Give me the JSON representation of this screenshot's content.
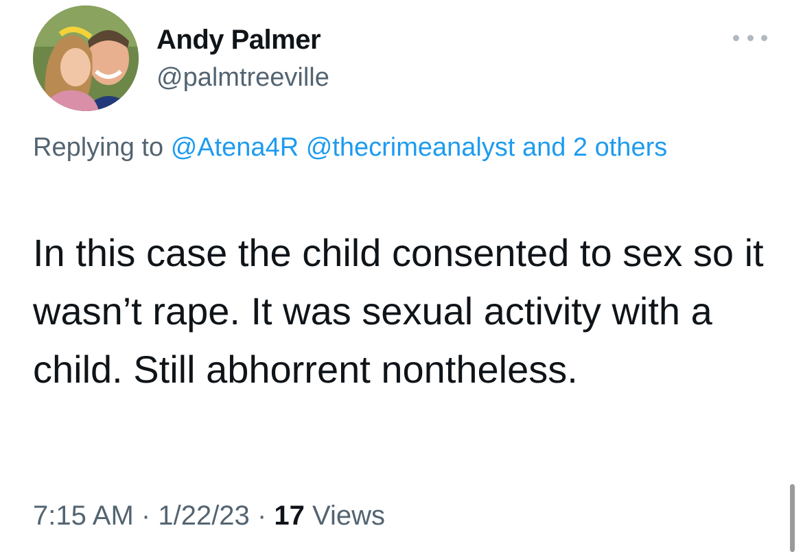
{
  "tweet": {
    "display_name": "Andy Palmer",
    "handle": "@palmtreeville",
    "reply_prefix": "Replying to",
    "reply_mentions": [
      "@Atena4R",
      "@thecrimeanalyst"
    ],
    "reply_others": "and 2 others",
    "text": "In this case the child consented to sex so it wasn’t rape. It was sexual activity with a child. Still abhorrent nontheless.",
    "time": "7:15 AM",
    "date": "1/22/23",
    "views_count": "17",
    "views_label": "Views",
    "separator": "·"
  },
  "icons": {
    "more": "more-horizontal-icon"
  },
  "colors": {
    "link": "#1d9bf0",
    "secondary_text": "#536471",
    "primary_text": "#0f1419",
    "background": "#ffffff"
  }
}
